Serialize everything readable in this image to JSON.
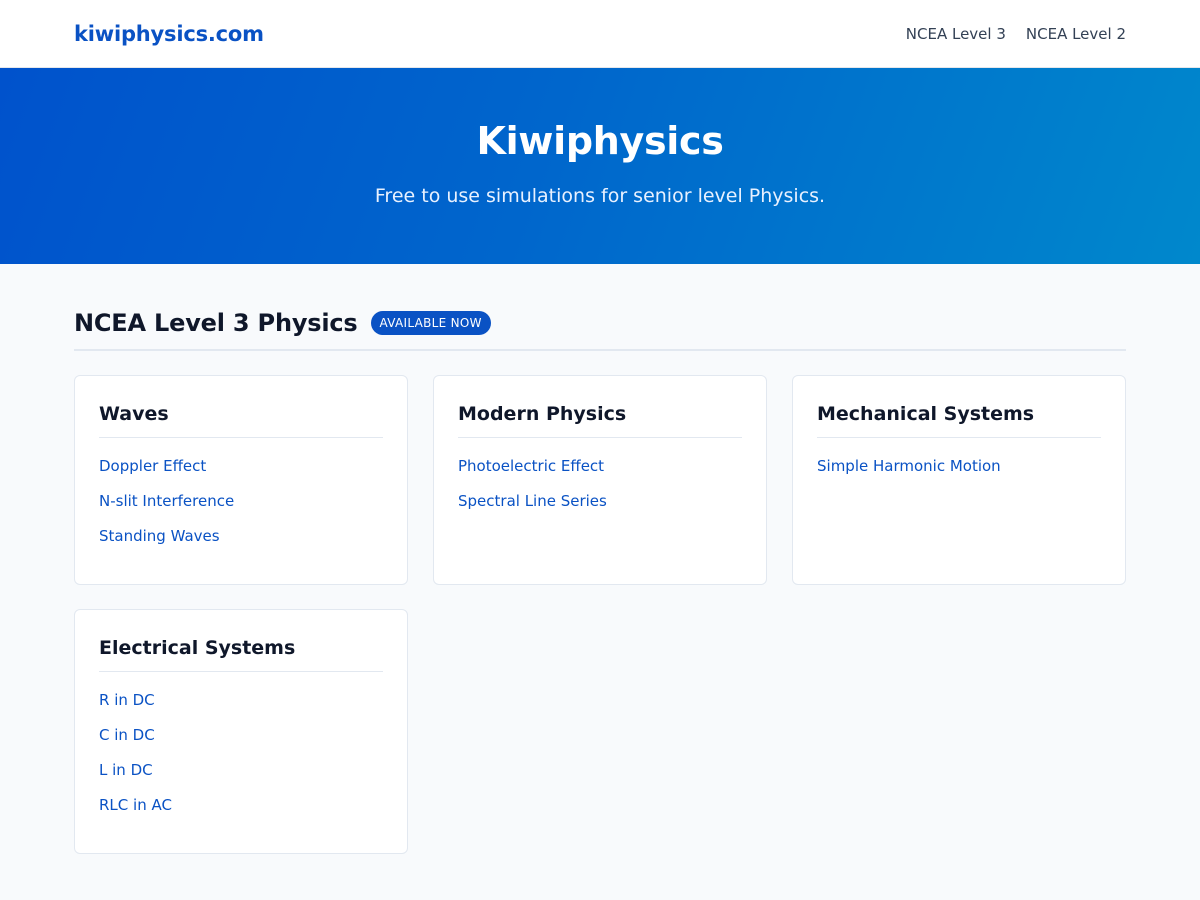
{
  "header": {
    "brand": "kiwiphysics.com",
    "nav": [
      "NCEA Level 3",
      "NCEA Level 2"
    ]
  },
  "hero": {
    "title": "Kiwiphysics",
    "subtitle": "Free to use simulations for senior level Physics."
  },
  "section": {
    "title": "NCEA Level 3 Physics",
    "badge": "AVAILABLE NOW"
  },
  "cards": [
    {
      "title": "Waves",
      "links": [
        "Doppler Effect",
        "N-slit Interference",
        "Standing Waves"
      ]
    },
    {
      "title": "Modern Physics",
      "links": [
        "Photoelectric Effect",
        "Spectral Line Series"
      ]
    },
    {
      "title": "Mechanical Systems",
      "links": [
        "Simple Harmonic Motion"
      ]
    },
    {
      "title": "Electrical Systems",
      "links": [
        "R in DC",
        "C in DC",
        "L in DC",
        "RLC in AC"
      ]
    }
  ],
  "colors": {
    "brand": "#0a52c4",
    "hero_start": "#0052cc",
    "hero_end": "#0088cc",
    "background": "#f8fafc"
  }
}
